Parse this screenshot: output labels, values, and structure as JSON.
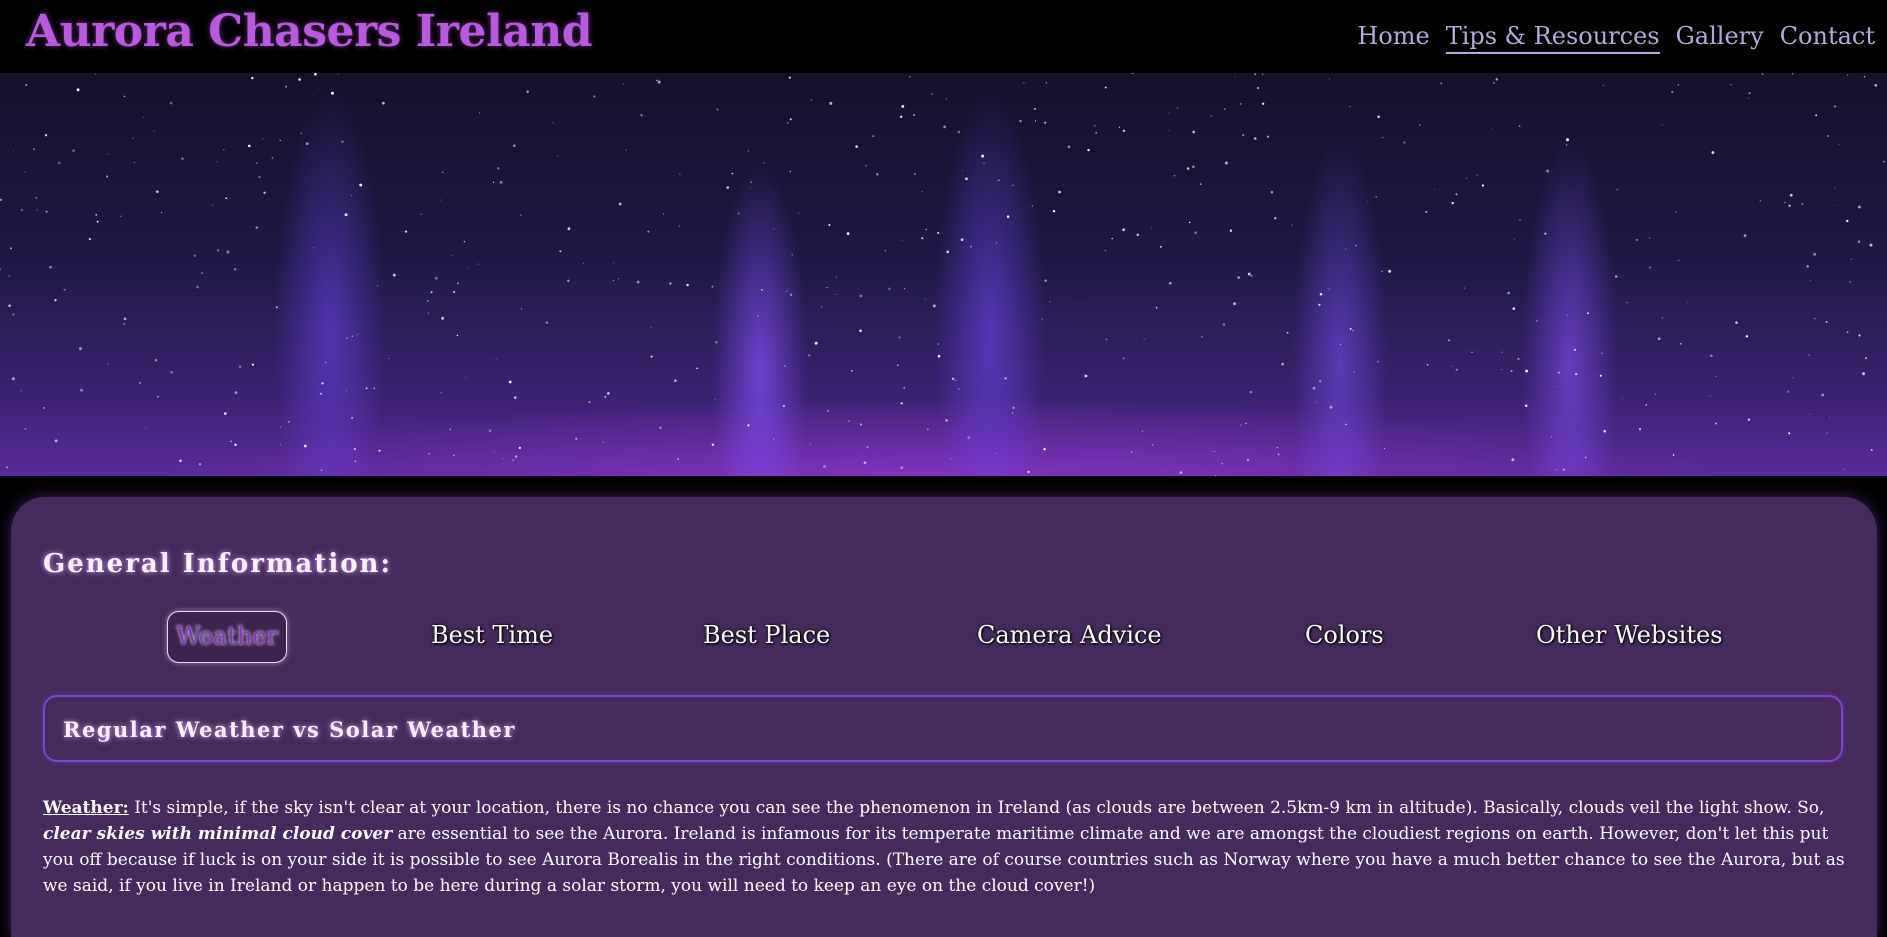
{
  "header": {
    "logo": "Aurora Chasers Ireland",
    "nav": [
      {
        "label": "Home",
        "active": false
      },
      {
        "label": "Tips & Resources",
        "active": true
      },
      {
        "label": "Gallery",
        "active": false
      },
      {
        "label": "Contact",
        "active": false
      }
    ]
  },
  "main": {
    "section_title": "General Information:",
    "tabs": [
      {
        "label": "Weather",
        "active": true
      },
      {
        "label": "Best Time",
        "active": false
      },
      {
        "label": "Best Place",
        "active": false
      },
      {
        "label": "Camera Advice",
        "active": false
      },
      {
        "label": "Colors",
        "active": false
      },
      {
        "label": "Other Websites",
        "active": false
      }
    ],
    "panel_title": "Regular Weather vs Solar Weather",
    "content": {
      "lead": "Weather:",
      "text_1": " It's simple, if the sky isn't clear at your location, there is no chance you can see the phenomenon in Ireland (as clouds are between 2.5km-9 km in altitude). Basically, clouds veil the light show. So, ",
      "emphasis": "clear skies with minimal cloud cover",
      "text_2": " are essential to see the Aurora. Ireland is infamous for its temperate maritime climate and we are amongst the cloudiest regions on earth. However, don't let this put you off because if luck is on your side it is possible to see Aurora Borealis in the right conditions. (There are of course countries such as Norway where you have a much better chance to see the Aurora, but as we said, if you live in Ireland or happen to be here during a solar storm, you will need to keep an eye on the cloud cover!)"
    }
  },
  "colors": {
    "logo": "#b85ae0",
    "nav": "#b6a8dd",
    "panel_bg": "#452a5b",
    "box_border": "#7f42d6",
    "active_tab_text": "#7f3bbf"
  }
}
